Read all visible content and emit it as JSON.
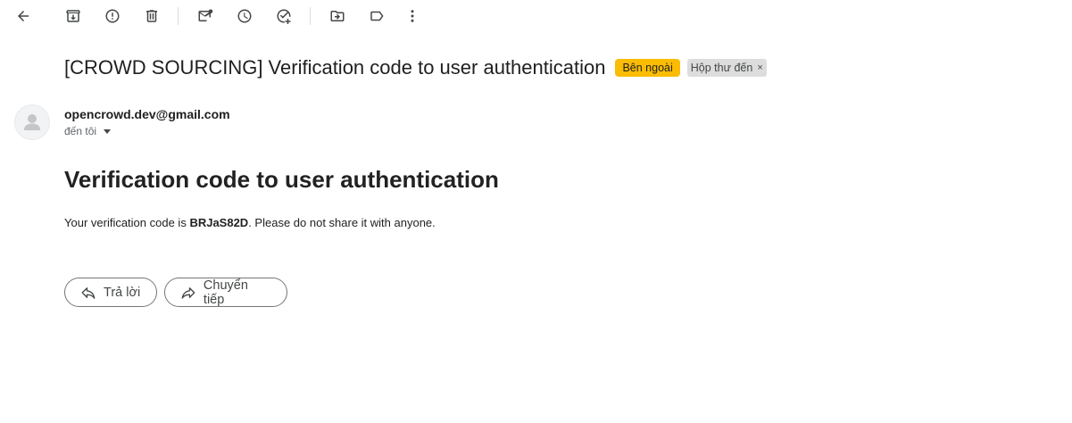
{
  "toolbar": {
    "icons": [
      "back-arrow-icon",
      "archive-icon",
      "report-spam-icon",
      "delete-icon",
      "mark-unread-icon",
      "snooze-icon",
      "add-to-tasks-icon",
      "move-to-icon",
      "label-icon",
      "more-options-icon"
    ]
  },
  "email": {
    "subject": "[CROWD SOURCING] Verification code to user authentication",
    "badges": {
      "external": "Bên ngoài",
      "inbox": "Hộp thư đến",
      "inbox_remove": "×"
    },
    "sender": "opencrowd.dev@gmail.com",
    "recipient_label": "đến tôi",
    "body": {
      "heading": "Verification code to user authentication",
      "text_before": "Your verification code is ",
      "code": "BRJaS82D",
      "text_after": ". Please do not share it with anyone."
    }
  },
  "actions": {
    "reply_label": "Trả lời",
    "forward_label": "Chuyển tiếp"
  },
  "colors": {
    "external_badge": "#fbbc04",
    "inbox_badge": "#dddddd",
    "icon": "#444746"
  }
}
